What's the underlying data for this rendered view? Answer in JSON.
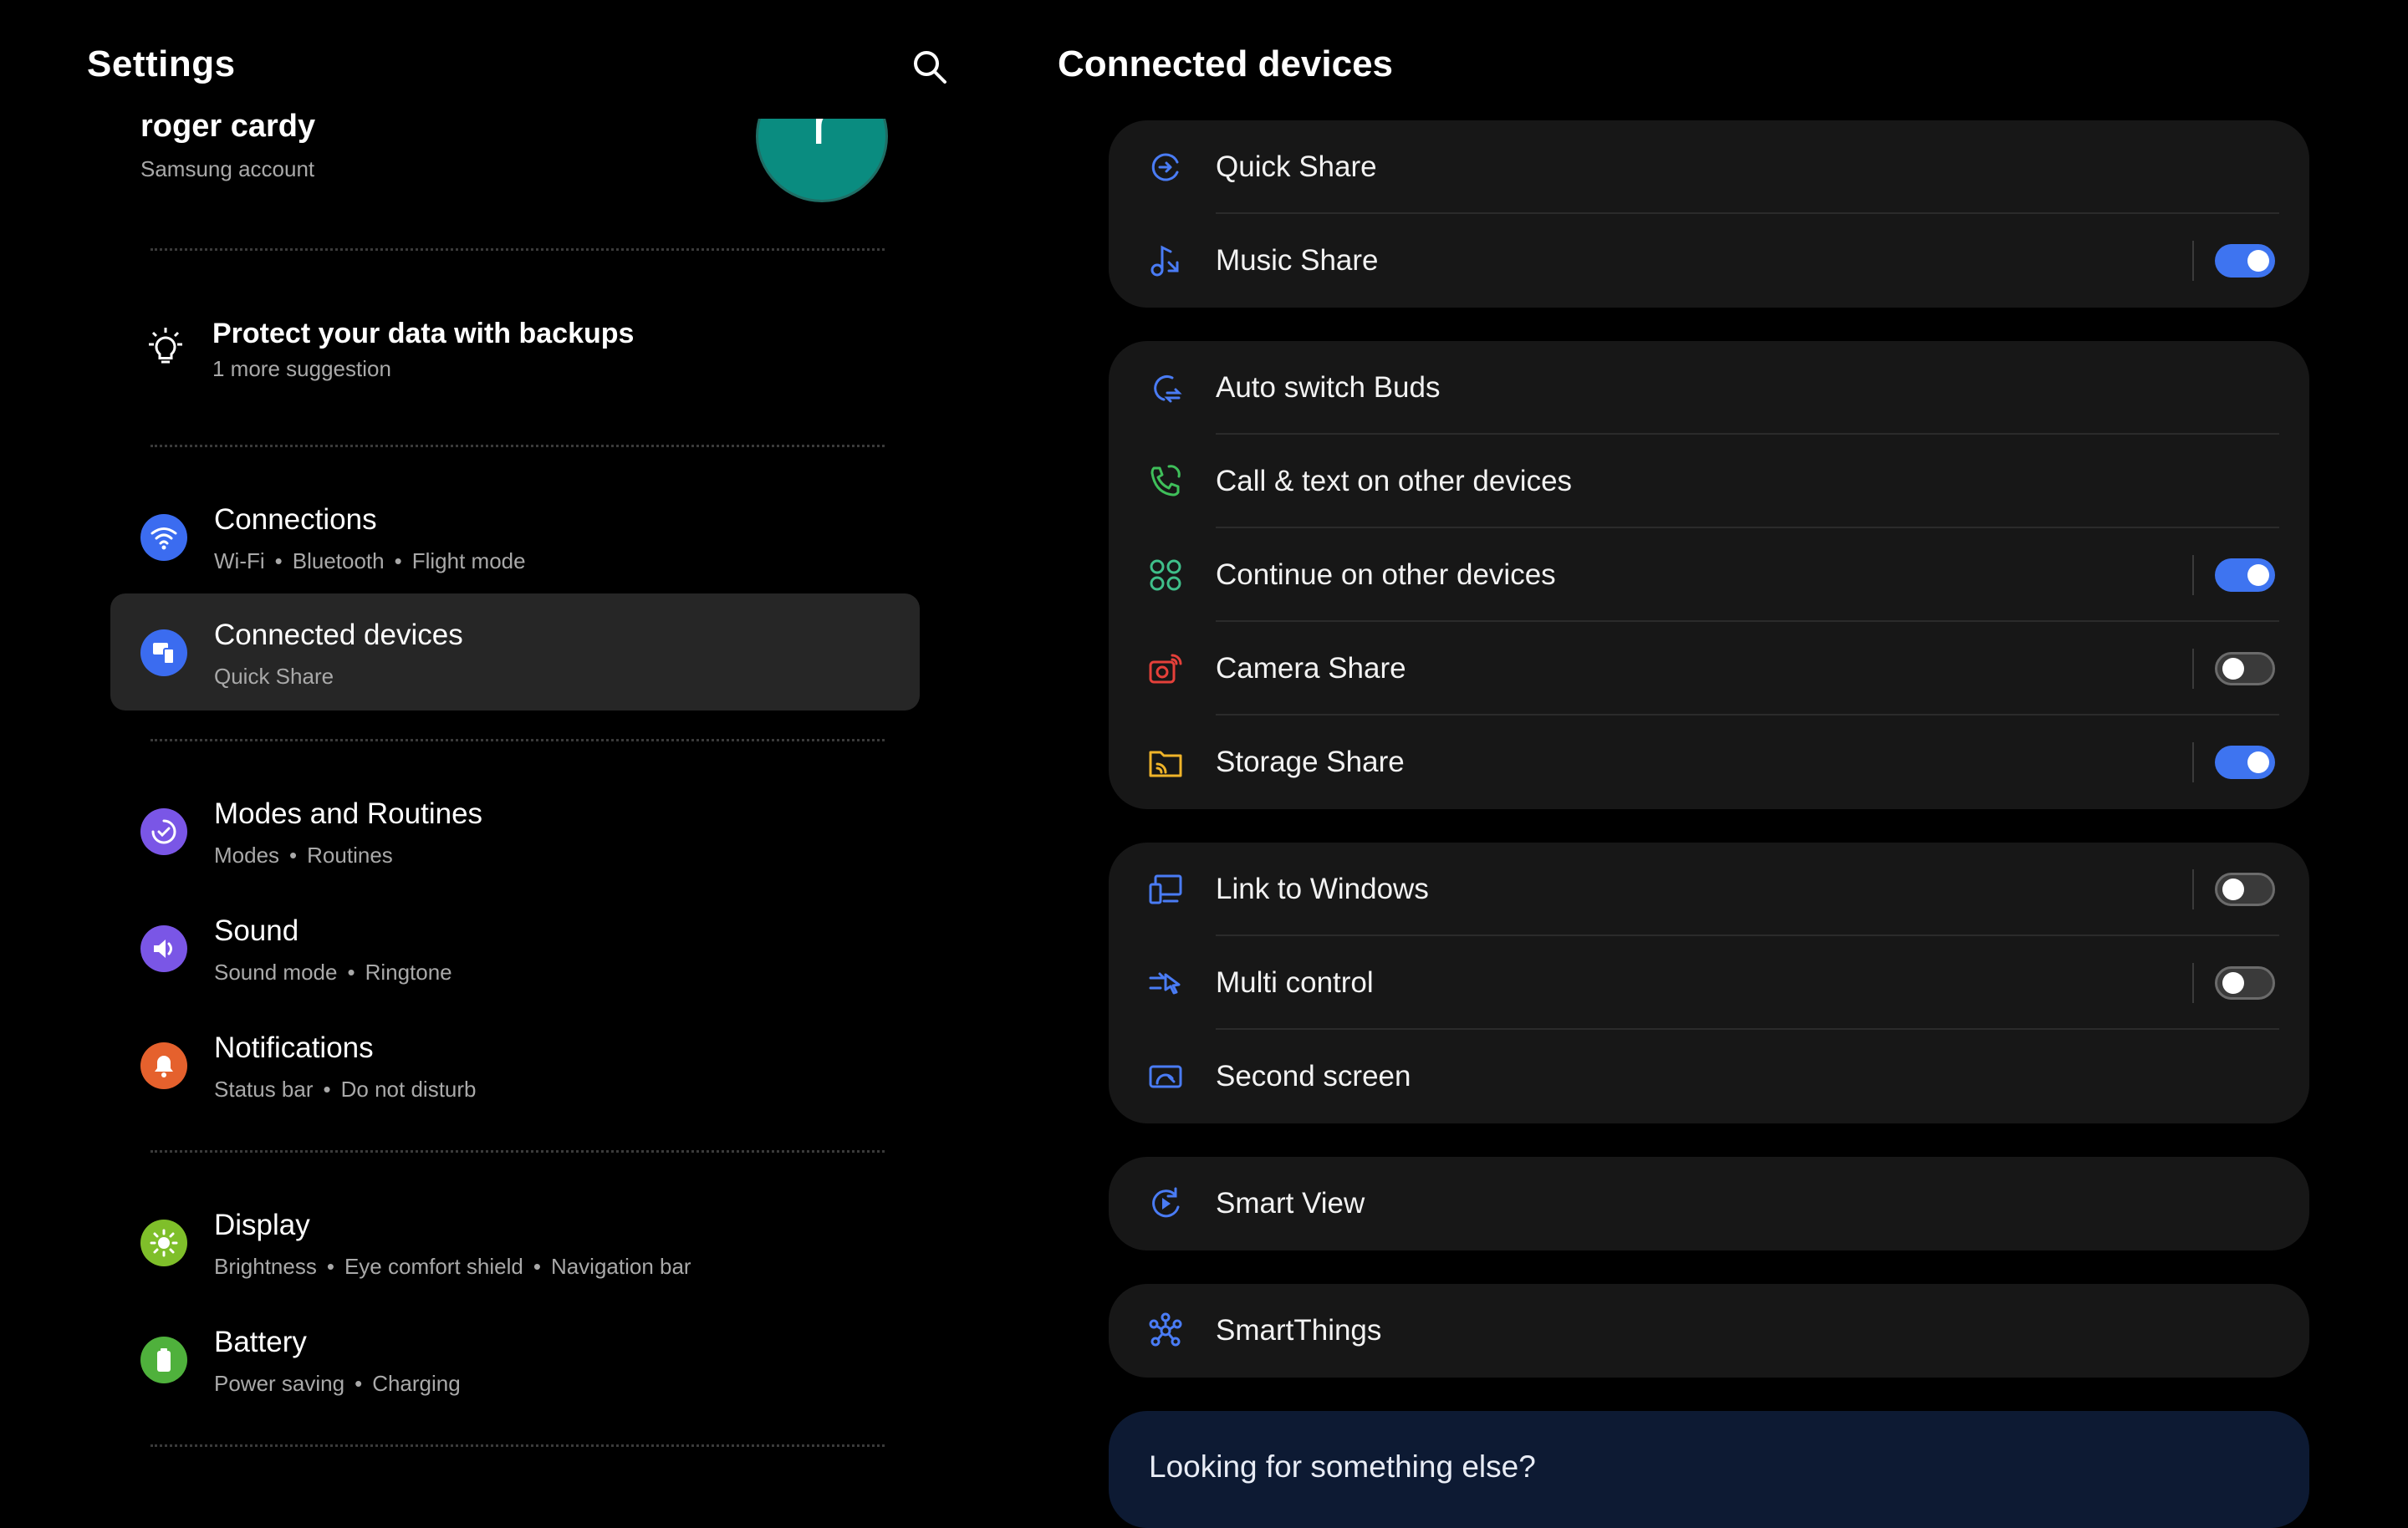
{
  "left": {
    "title": "Settings",
    "account": {
      "name": "roger cardy",
      "subtitle": "Samsung account",
      "avatar_letter": "r",
      "avatar_color": "#0a8c80"
    },
    "suggestion": {
      "title": "Protect your data with backups",
      "subtitle": "1 more suggestion"
    },
    "menu": [
      {
        "title": "Connections",
        "sub": [
          "Wi-Fi",
          "Bluetooth",
          "Flight mode"
        ],
        "icon": "wifi-icon",
        "color": "#3b6cf0"
      },
      {
        "title": "Connected devices",
        "sub": [
          "Quick Share"
        ],
        "icon": "connected-devices-icon",
        "color": "#3b6cf0",
        "selected": true
      },
      {
        "title": "Modes and Routines",
        "sub": [
          "Modes",
          "Routines"
        ],
        "icon": "modes-routines-icon",
        "color": "#7a56e6"
      },
      {
        "title": "Sound",
        "sub": [
          "Sound mode",
          "Ringtone"
        ],
        "icon": "volume-icon",
        "color": "#7a56e6"
      },
      {
        "title": "Notifications",
        "sub": [
          "Status bar",
          "Do not disturb"
        ],
        "icon": "bell-icon",
        "color": "#e5612d"
      },
      {
        "title": "Display",
        "sub": [
          "Brightness",
          "Eye comfort shield",
          "Navigation bar"
        ],
        "icon": "sun-icon",
        "color": "#7fbf2a"
      },
      {
        "title": "Battery",
        "sub": [
          "Power saving",
          "Charging"
        ],
        "icon": "battery-icon",
        "color": "#4fb13c"
      }
    ],
    "separator_dot": "•"
  },
  "right": {
    "title": "Connected devices",
    "groups": [
      [
        {
          "label": "Quick Share",
          "icon": "quick-share-icon",
          "icon_color": "#4a7cf5",
          "toggle": null
        },
        {
          "label": "Music Share",
          "icon": "music-share-icon",
          "icon_color": "#4a7cf5",
          "toggle": true
        }
      ],
      [
        {
          "label": "Auto switch Buds",
          "icon": "auto-switch-buds-icon",
          "icon_color": "#4a7cf5",
          "toggle": null
        },
        {
          "label": "Call & text on other devices",
          "icon": "call-text-icon",
          "icon_color": "#3fbf5a",
          "toggle": null
        },
        {
          "label": "Continue on other devices",
          "icon": "continue-apps-icon",
          "icon_color": "#3fbf8a",
          "toggle": true
        },
        {
          "label": "Camera Share",
          "icon": "camera-share-icon",
          "icon_color": "#e5403a",
          "toggle": false
        },
        {
          "label": "Storage Share",
          "icon": "storage-share-icon",
          "icon_color": "#f0b429",
          "toggle": true
        }
      ],
      [
        {
          "label": "Link to Windows",
          "icon": "link-to-windows-icon",
          "icon_color": "#4a7cf5",
          "toggle": false
        },
        {
          "label": "Multi control",
          "icon": "multi-control-icon",
          "icon_color": "#4a7cf5",
          "toggle": false
        },
        {
          "label": "Second screen",
          "icon": "second-screen-icon",
          "icon_color": "#4a7cf5",
          "toggle": null
        }
      ],
      [
        {
          "label": "Smart View",
          "icon": "smart-view-icon",
          "icon_color": "#4a7cf5",
          "toggle": null
        }
      ],
      [
        {
          "label": "SmartThings",
          "icon": "smartthings-icon",
          "icon_color": "#4a7cf5",
          "toggle": null
        }
      ]
    ],
    "looking": "Looking for something else?",
    "toggle_on_color": "#3e74f0"
  }
}
